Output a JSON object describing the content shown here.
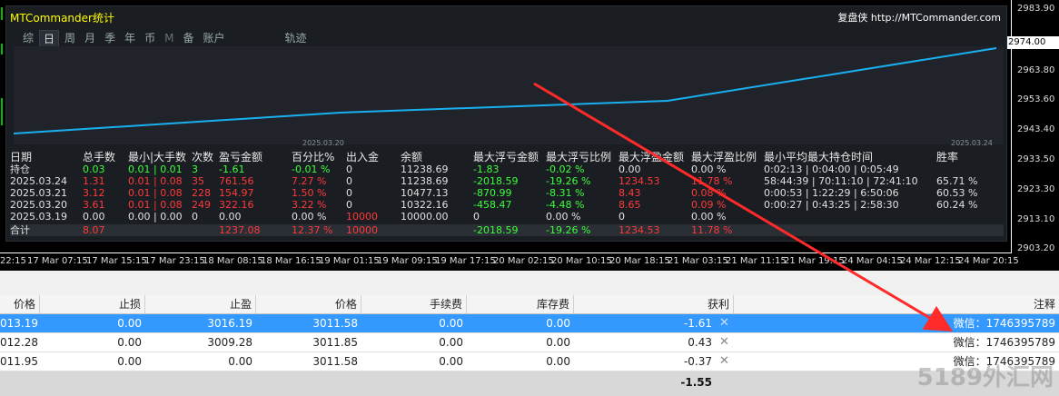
{
  "mtc": {
    "title": "MTCommander统计",
    "site_cn": "复盘侠",
    "site_url": "http://MTCommander.com",
    "tabs": [
      "综",
      "日",
      "周",
      "月",
      "季",
      "年",
      "币",
      "M",
      "备",
      "账户",
      "轨迹"
    ],
    "active_tab": "日",
    "chart_dates": [
      "2025.03.20",
      "2025.03.24"
    ],
    "headers": [
      "日期",
      "总手数",
      "最小|大手数",
      "次数",
      "盈亏金额",
      "百分比%",
      "出入金",
      "余额",
      "最大浮亏金额",
      "最大浮亏比例",
      "最大浮盈金额",
      "最大浮盈比例",
      "最小平均最大持仓时间",
      "胜率"
    ],
    "rows": [
      {
        "date": "持仓",
        "lots": "0.03",
        "minmax": "0.01 | 0.01",
        "count": "3",
        "pnl": "-1.61",
        "pct": "-0.01 %",
        "inout": "0",
        "balance": "11238.69",
        "maxloss": "-1.83",
        "maxlosspct": "-0.02 %",
        "maxprofit": "0.00",
        "maxprofitpct": "0.00 %",
        "hold": "0:02:13 | 0:04:00 | 0:05:49",
        "win": ""
      },
      {
        "date": "2025.03.24",
        "lots": "1.31",
        "minmax": "0.01 | 0.08",
        "count": "35",
        "pnl": "761.56",
        "pct": "7.27 %",
        "inout": "0",
        "balance": "11238.69",
        "maxloss": "-2018.59",
        "maxlosspct": "-19.26 %",
        "maxprofit": "1234.53",
        "maxprofitpct": "11.78 %",
        "hold": "58:44:39 | 70:11:10 | 72:41:10",
        "win": "65.71 %"
      },
      {
        "date": "2025.03.21",
        "lots": "3.12",
        "minmax": "0.01 | 0.08",
        "count": "228",
        "pnl": "154.97",
        "pct": "1.50 %",
        "inout": "0",
        "balance": "10477.13",
        "maxloss": "-870.99",
        "maxlosspct": "-8.31 %",
        "maxprofit": "8.43",
        "maxprofitpct": "0.08 %",
        "hold": "0:00:53 | 1:22:29 | 6:50:06",
        "win": "60.53 %"
      },
      {
        "date": "2025.03.20",
        "lots": "3.61",
        "minmax": "0.01 | 0.08",
        "count": "249",
        "pnl": "322.16",
        "pct": "3.22 %",
        "inout": "0",
        "balance": "10322.16",
        "maxloss": "-458.47",
        "maxlosspct": "-4.48 %",
        "maxprofit": "8.65",
        "maxprofitpct": "0.09 %",
        "hold": "0:00:27 | 0:43:25 | 2:58:30",
        "win": "60.24 %"
      },
      {
        "date": "2025.03.19",
        "lots": "0.00",
        "minmax": "0.00 | 0.00",
        "count": "0",
        "pnl": "0.00",
        "pct": "0.00 %",
        "inout": "10000",
        "balance": "10000.00",
        "maxloss": "0",
        "maxlosspct": "0.00 %",
        "maxprofit": "0",
        "maxprofitpct": "0.00 %",
        "hold": "",
        "win": ""
      }
    ],
    "total": {
      "label": "合计",
      "lots": "8.07",
      "pnl": "1237.08",
      "pct": "12.37 %",
      "inout": "10000",
      "maxloss": "-2018.59",
      "maxlosspct": "-19.26 %",
      "maxprofit": "1234.53",
      "maxprofitpct": "11.78 %"
    }
  },
  "price_axis": [
    "2983.90",
    "2974.00",
    "2963.80",
    "2953.60",
    "2943.40",
    "2933.50",
    "2923.30",
    "2913.10",
    "2903.20"
  ],
  "current_price": "2974.00",
  "time_axis": [
    "22:15",
    "17 Mar 07:15",
    "17 Mar 15:15",
    "17 Mar 23:15",
    "18 Mar 08:15",
    "18 Mar 16:15",
    "19 Mar 01:15",
    "19 Mar 09:15",
    "19 Mar 17:15",
    "20 Mar 02:15",
    "20 Mar 10:15",
    "20 Mar 18:15",
    "21 Mar 03:15",
    "21 Mar 11:15",
    "21 Mar 19:15",
    "24 Mar 04:15",
    "24 Mar 12:15",
    "24 Mar 20:15"
  ],
  "orders": {
    "headers": [
      "价格",
      "止损",
      "止盈",
      "价格",
      "手续费",
      "库存费",
      "获利",
      "注释"
    ],
    "rows": [
      {
        "price": "013.19",
        "sl": "0.00",
        "tp": "3016.19",
        "cur": "3011.58",
        "fee": "0.00",
        "swap": "0.00",
        "profit": "-1.61",
        "comment": "微信：1746395789",
        "selected": true
      },
      {
        "price": "012.28",
        "sl": "0.00",
        "tp": "3009.28",
        "cur": "3011.85",
        "fee": "0.00",
        "swap": "0.00",
        "profit": "0.43",
        "comment": "微信：1746395789",
        "selected": false
      },
      {
        "price": "011.95",
        "sl": "0.00",
        "tp": "0.00",
        "cur": "3011.58",
        "fee": "0.00",
        "swap": "0.00",
        "profit": "-0.37",
        "comment": "微信：1746395789",
        "selected": false
      }
    ],
    "total_profit": "-1.55"
  },
  "watermark": "5189外汇网",
  "colors": {
    "accent_line": "#1ab0f0",
    "selected_row": "#3399ff",
    "arrow": "#ff2a2a"
  }
}
